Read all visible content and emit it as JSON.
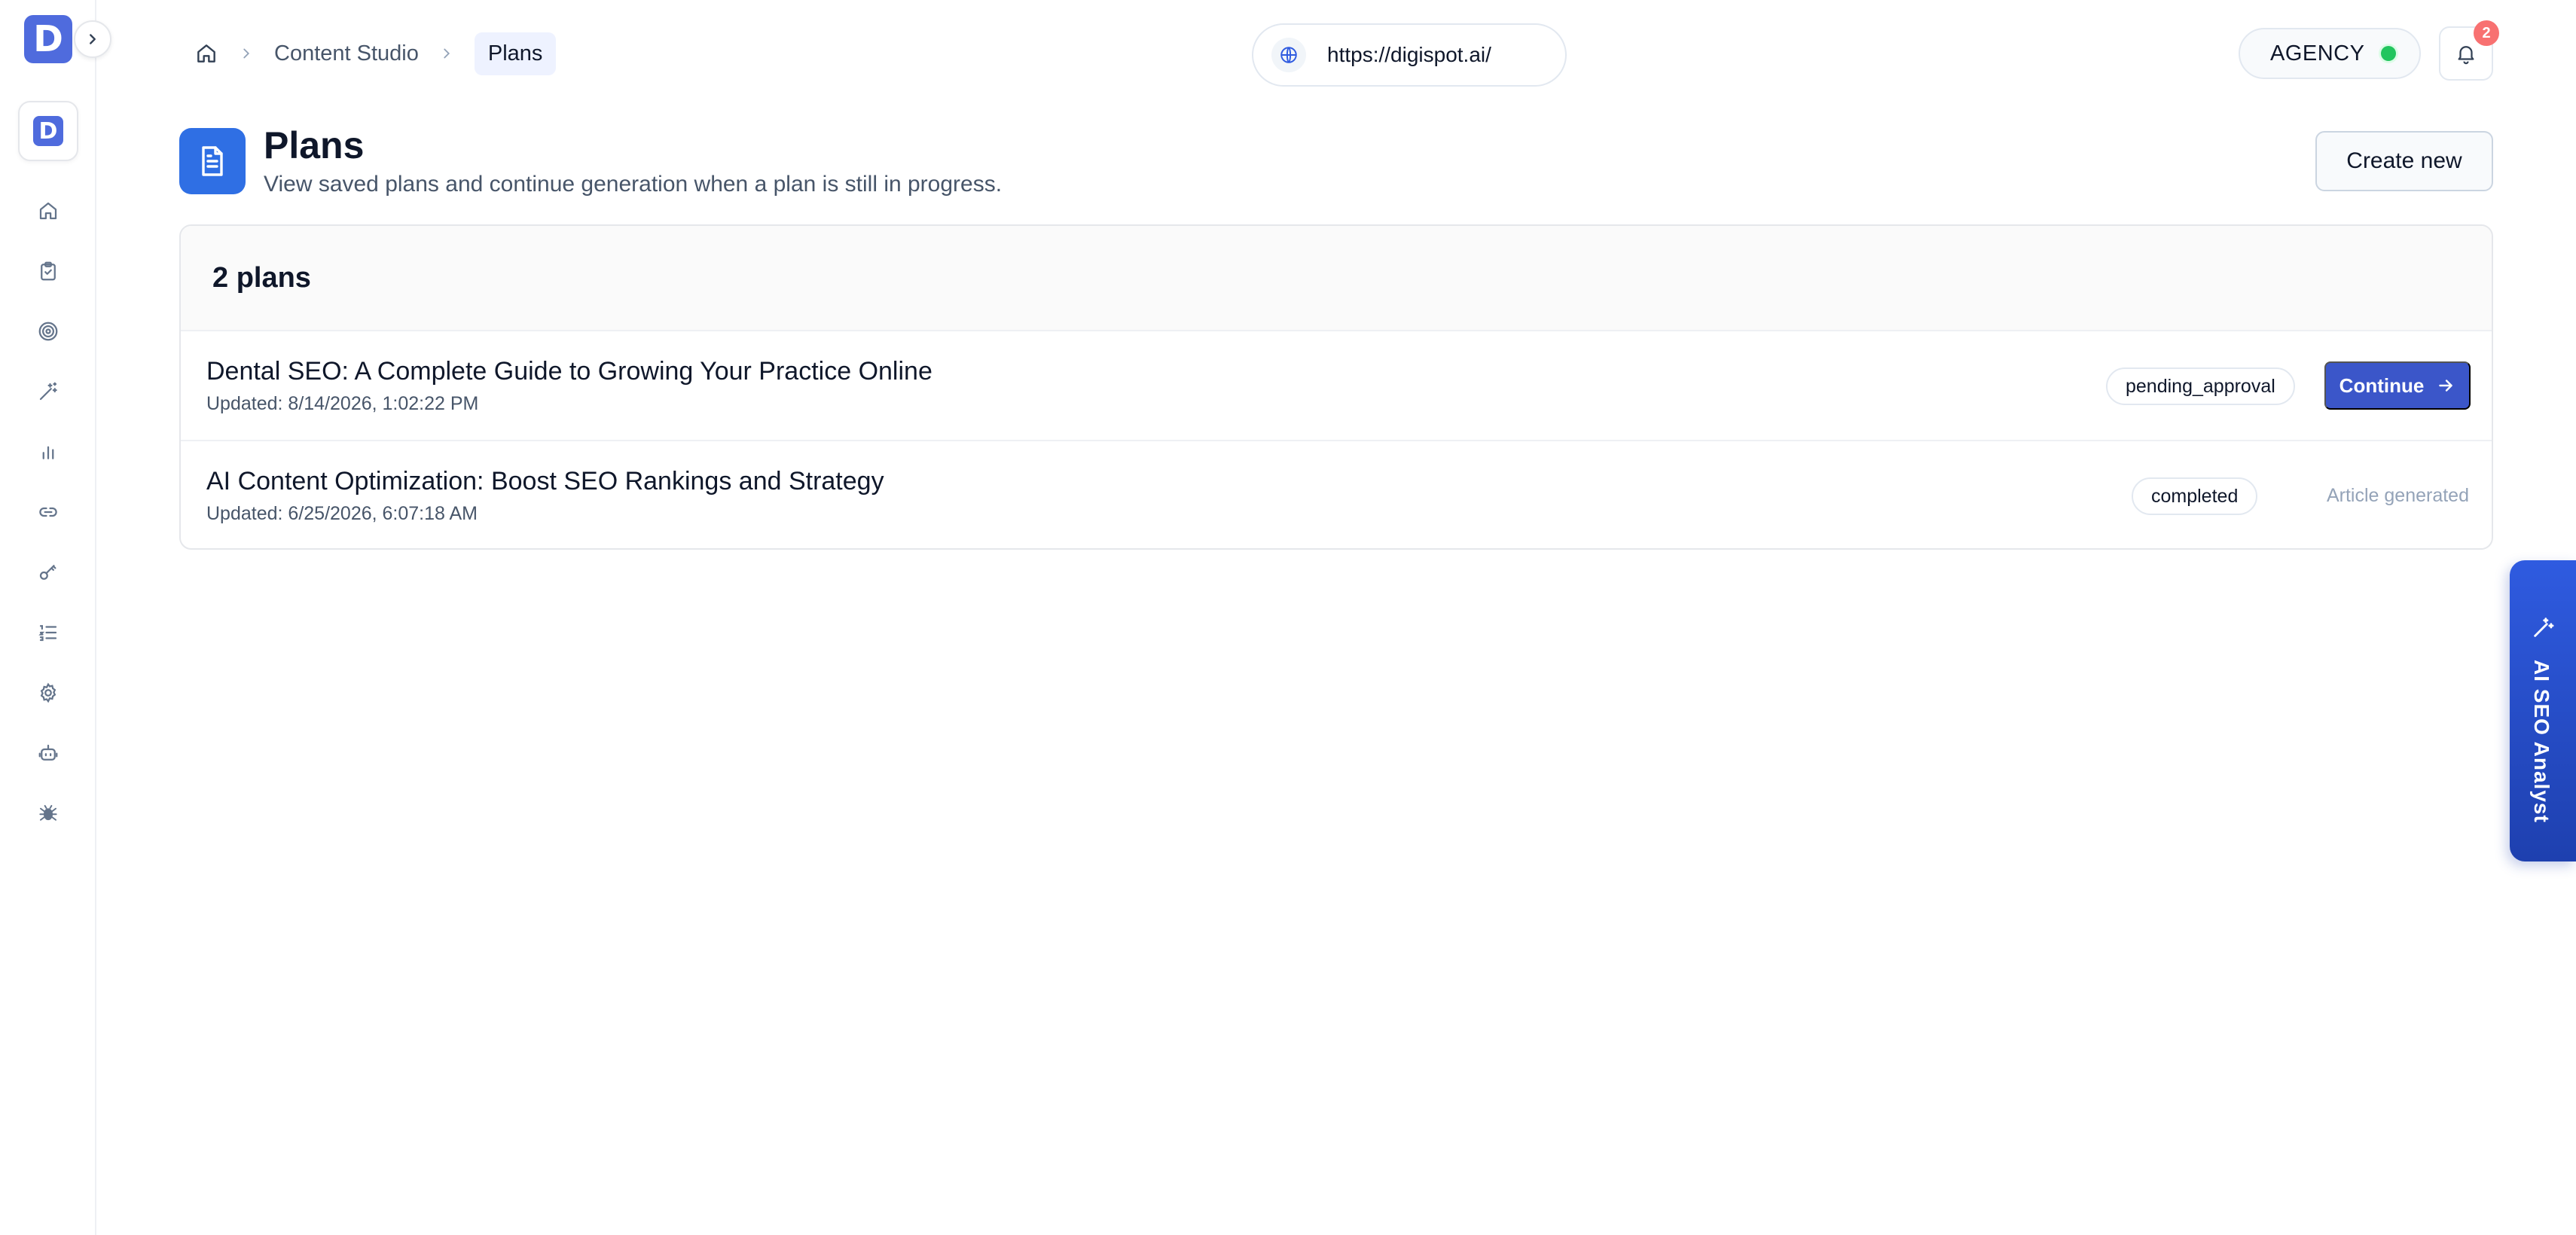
{
  "sidebar": {
    "logo_letter": "D",
    "brand_letter": "D",
    "items": [
      {
        "name": "home",
        "icon": "home-icon"
      },
      {
        "name": "tasks",
        "icon": "clipboard-check-icon"
      },
      {
        "name": "targets",
        "icon": "target-icon"
      },
      {
        "name": "content",
        "icon": "magic-wand-icon"
      },
      {
        "name": "analytics",
        "icon": "bar-chart-icon"
      },
      {
        "name": "links",
        "icon": "link-icon"
      },
      {
        "name": "keywords",
        "icon": "key-icon"
      },
      {
        "name": "lists",
        "icon": "list-ordered-icon"
      },
      {
        "name": "settings",
        "icon": "gear-icon"
      },
      {
        "name": "bots",
        "icon": "bot-icon"
      },
      {
        "name": "crawler",
        "icon": "bug-icon"
      }
    ]
  },
  "topbar": {
    "breadcrumb": {
      "parent": "Content Studio",
      "current": "Plans"
    },
    "url": "https://digispot.ai/",
    "plan_label": "AGENCY",
    "notification_count": "2"
  },
  "header": {
    "title": "Plans",
    "subtitle": "View saved plans and continue generation when a plan is still in progress.",
    "create_label": "Create new"
  },
  "plans": {
    "count_label": "2 plans",
    "rows": [
      {
        "title": "Dental SEO: A Complete Guide to Growing Your Practice Online",
        "updated": "Updated: 8/14/2026, 1:02:22 PM",
        "status": "pending_approval",
        "action_label": "Continue"
      },
      {
        "title": "AI Content Optimization: Boost SEO Rankings and Strategy",
        "updated": "Updated: 6/25/2026, 6:07:18 AM",
        "status": "completed",
        "note": "Article generated"
      }
    ]
  },
  "assistant_tab": {
    "label": "AI SEO Analyst"
  },
  "colors": {
    "accent": "#3b56c9",
    "brand": "#4f6bdd",
    "status_online": "#22c55e",
    "badge": "#f87171"
  }
}
